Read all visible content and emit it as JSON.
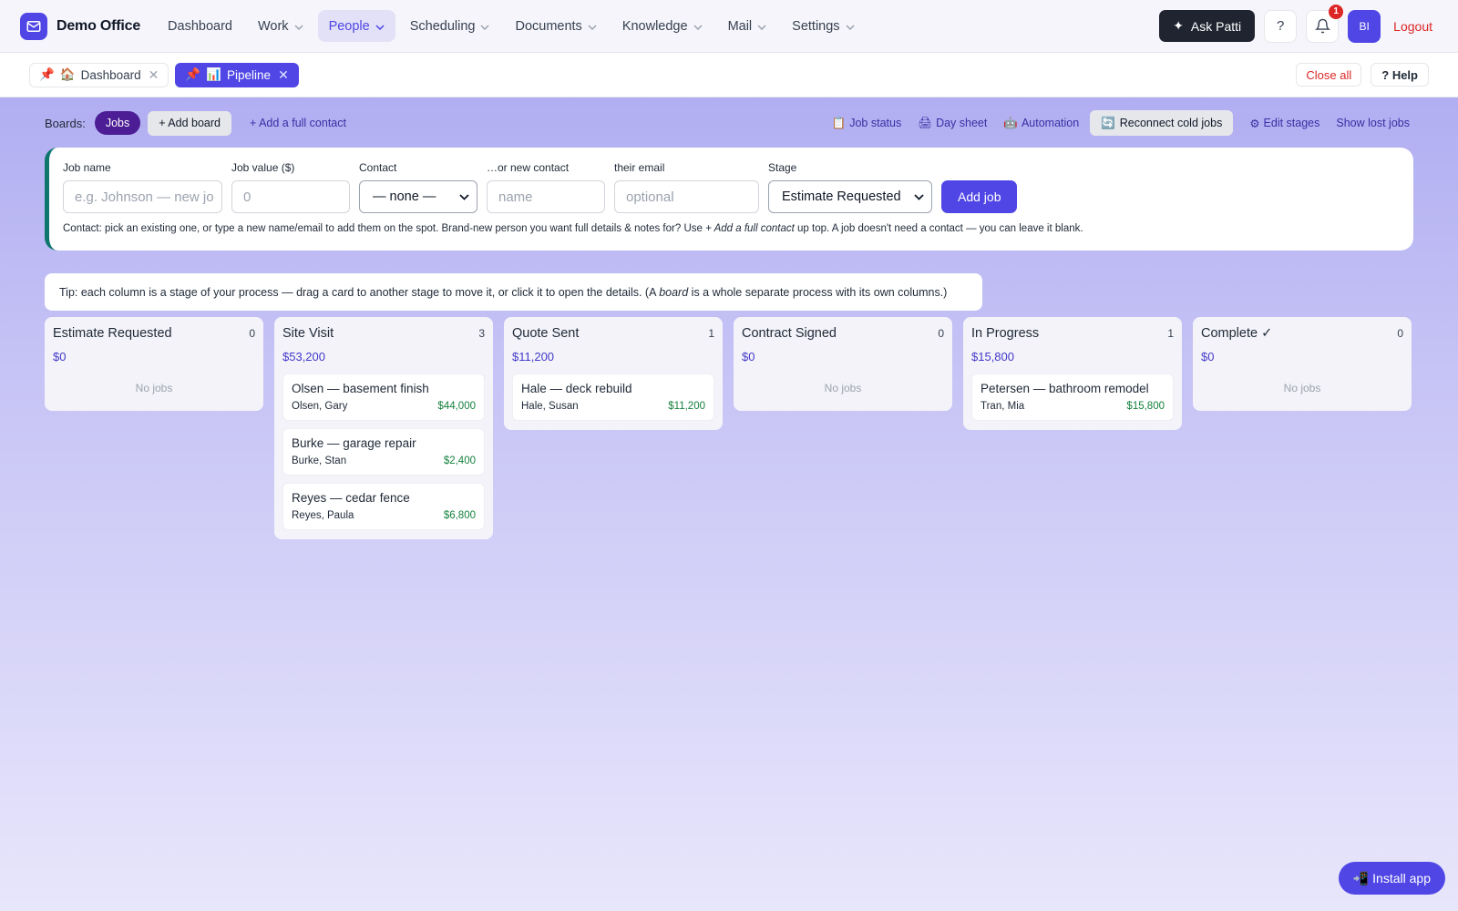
{
  "brand": {
    "name": "Demo Office"
  },
  "nav": {
    "items": [
      {
        "label": "Dashboard",
        "dropdown": false,
        "active": false
      },
      {
        "label": "Work",
        "dropdown": true,
        "active": false
      },
      {
        "label": "People",
        "dropdown": true,
        "active": true
      },
      {
        "label": "Scheduling",
        "dropdown": true,
        "active": false
      },
      {
        "label": "Documents",
        "dropdown": true,
        "active": false
      },
      {
        "label": "Knowledge",
        "dropdown": true,
        "active": false
      },
      {
        "label": "Mail",
        "dropdown": true,
        "active": false
      },
      {
        "label": "Settings",
        "dropdown": true,
        "active": false
      }
    ],
    "ask_label": "Ask Patti",
    "help_label": "?",
    "notif_count": "1",
    "avatar_initials": "BI",
    "logout_label": "Logout"
  },
  "tabs": {
    "items": [
      {
        "pin": "📌",
        "emoji": "🏠",
        "label": "Dashboard",
        "active": false
      },
      {
        "pin": "📌",
        "emoji": "📊",
        "label": "Pipeline",
        "active": true
      }
    ],
    "close_all": "Close all",
    "help": "? Help"
  },
  "boardbar": {
    "boards_label": "Boards:",
    "active_board": "Jobs",
    "add_board": "+ Add board",
    "add_contact": "+ Add a full contact",
    "actions": [
      {
        "icon": "📋",
        "label": "Job status"
      },
      {
        "icon": "🖨",
        "label": "Day sheet"
      },
      {
        "icon": "🤖",
        "label": "Automation"
      }
    ],
    "reconnect": {
      "icon": "🔄",
      "label": "Reconnect cold jobs"
    },
    "edit_stages": {
      "icon": "⚙",
      "label": "Edit stages"
    },
    "show_lost": "Show lost jobs"
  },
  "form": {
    "job_name": {
      "label": "Job name",
      "placeholder": "e.g. Johnson — new jo"
    },
    "job_value": {
      "label": "Job value ($)",
      "placeholder": "0"
    },
    "contact": {
      "label": "Contact",
      "value": "— none —"
    },
    "new_contact": {
      "label": "…or new contact",
      "placeholder": "name"
    },
    "email": {
      "label": "their email",
      "placeholder": "optional"
    },
    "stage": {
      "label": "Stage",
      "value": "Estimate Requested"
    },
    "submit": "Add job",
    "help_before": "Contact: pick an existing one, or type a new name/email to add them on the spot. Brand-new person you want full details & notes for? Use ",
    "help_em": "+ Add a full contact",
    "help_after": " up top. A job doesn't need a contact — you can leave it blank."
  },
  "tip": {
    "before": "Tip: each column is a stage of your process — drag a card to another stage to move it, or click it to open the details. (A ",
    "em": "board",
    "after": " is a whole separate process with its own columns.)"
  },
  "columns": [
    {
      "title": "Estimate Requested",
      "count": "0",
      "total": "$0",
      "empty": "No jobs",
      "cards": []
    },
    {
      "title": "Site Visit",
      "count": "3",
      "total": "$53,200",
      "empty": "",
      "cards": [
        {
          "title": "Olsen — basement finish",
          "contact": "Olsen, Gary",
          "value": "$44,000"
        },
        {
          "title": "Burke — garage repair",
          "contact": "Burke, Stan",
          "value": "$2,400"
        },
        {
          "title": "Reyes — cedar fence",
          "contact": "Reyes, Paula",
          "value": "$6,800"
        }
      ]
    },
    {
      "title": "Quote Sent",
      "count": "1",
      "total": "$11,200",
      "empty": "",
      "cards": [
        {
          "title": "Hale — deck rebuild",
          "contact": "Hale, Susan",
          "value": "$11,200"
        }
      ]
    },
    {
      "title": "Contract Signed",
      "count": "0",
      "total": "$0",
      "empty": "No jobs",
      "cards": []
    },
    {
      "title": "In Progress",
      "count": "1",
      "total": "$15,800",
      "empty": "",
      "cards": [
        {
          "title": "Petersen — bathroom remodel",
          "contact": "Tran, Mia",
          "value": "$15,800"
        }
      ]
    },
    {
      "title": "Complete ✓",
      "count": "0",
      "total": "$0",
      "empty": "No jobs",
      "cards": []
    }
  ],
  "install": {
    "icon": "📲",
    "label": "Install app"
  },
  "colors": {
    "accent": "#4f46e5",
    "value_green": "#15803d",
    "danger": "#dc2626"
  }
}
